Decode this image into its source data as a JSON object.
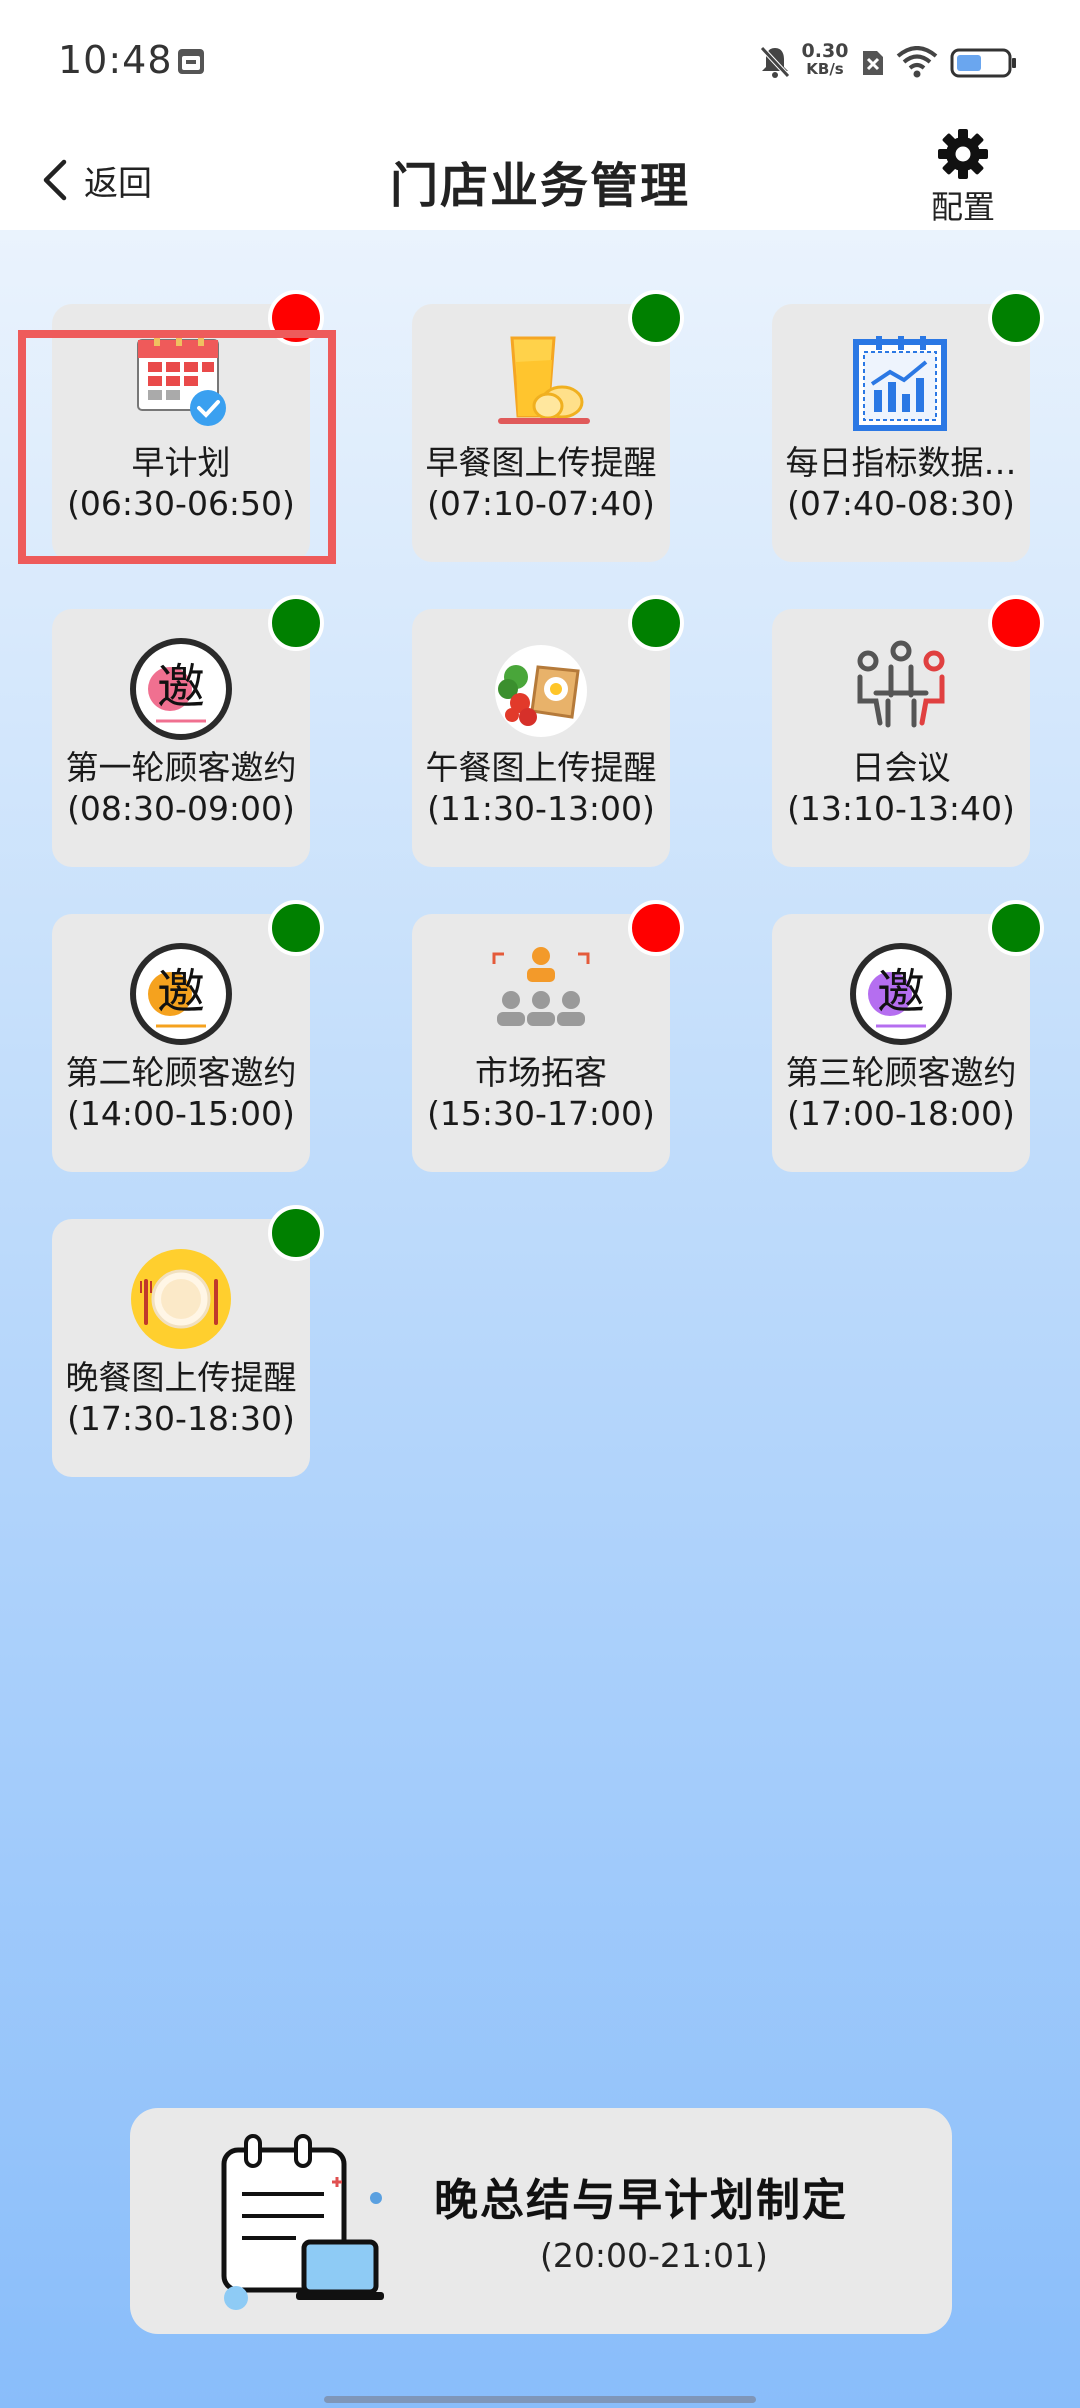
{
  "status_bar": {
    "time": "10:48",
    "net_speed": "0.30",
    "net_unit": "KB/s"
  },
  "header": {
    "back_label": "返回",
    "title": "门店业务管理",
    "config_label": "配置"
  },
  "tiles": [
    {
      "name": "早计划",
      "time": "(06:30-06:50)",
      "icon": "calendar-check-icon",
      "status": "red"
    },
    {
      "name": "早餐图上传提醒",
      "time": "(07:10-07:40)",
      "icon": "breakfast-icon",
      "status": "green"
    },
    {
      "name": "每日指标数据…",
      "time": "(07:40-08:30)",
      "icon": "data-chart-icon",
      "status": "green"
    },
    {
      "name": "第一轮顾客邀约",
      "time": "(08:30-09:00)",
      "icon": "invite-badge-pink-icon",
      "status": "green"
    },
    {
      "name": "午餐图上传提醒",
      "time": "(11:30-13:00)",
      "icon": "lunch-icon",
      "status": "green"
    },
    {
      "name": "日会议",
      "time": "(13:10-13:40)",
      "icon": "meeting-icon",
      "status": "red"
    },
    {
      "name": "第二轮顾客邀约",
      "time": "(14:00-15:00)",
      "icon": "invite-badge-orange-icon",
      "status": "green"
    },
    {
      "name": "市场拓客",
      "time": "(15:30-17:00)",
      "icon": "audience-icon",
      "status": "red"
    },
    {
      "name": "第三轮顾客邀约",
      "time": "(17:00-18:00)",
      "icon": "invite-badge-purple-icon",
      "status": "green"
    },
    {
      "name": "晚餐图上传提醒",
      "time": "(17:30-18:30)",
      "icon": "dinner-plate-icon",
      "status": "green"
    }
  ],
  "invite_char": "邀",
  "summary": {
    "title": "晚总结与早计划制定",
    "time": "(20:00-21:01)",
    "icon": "notepad-laptop-icon"
  },
  "colors": {
    "red": "#ff0000",
    "green": "#008000",
    "highlight": "#ee5b5b"
  }
}
